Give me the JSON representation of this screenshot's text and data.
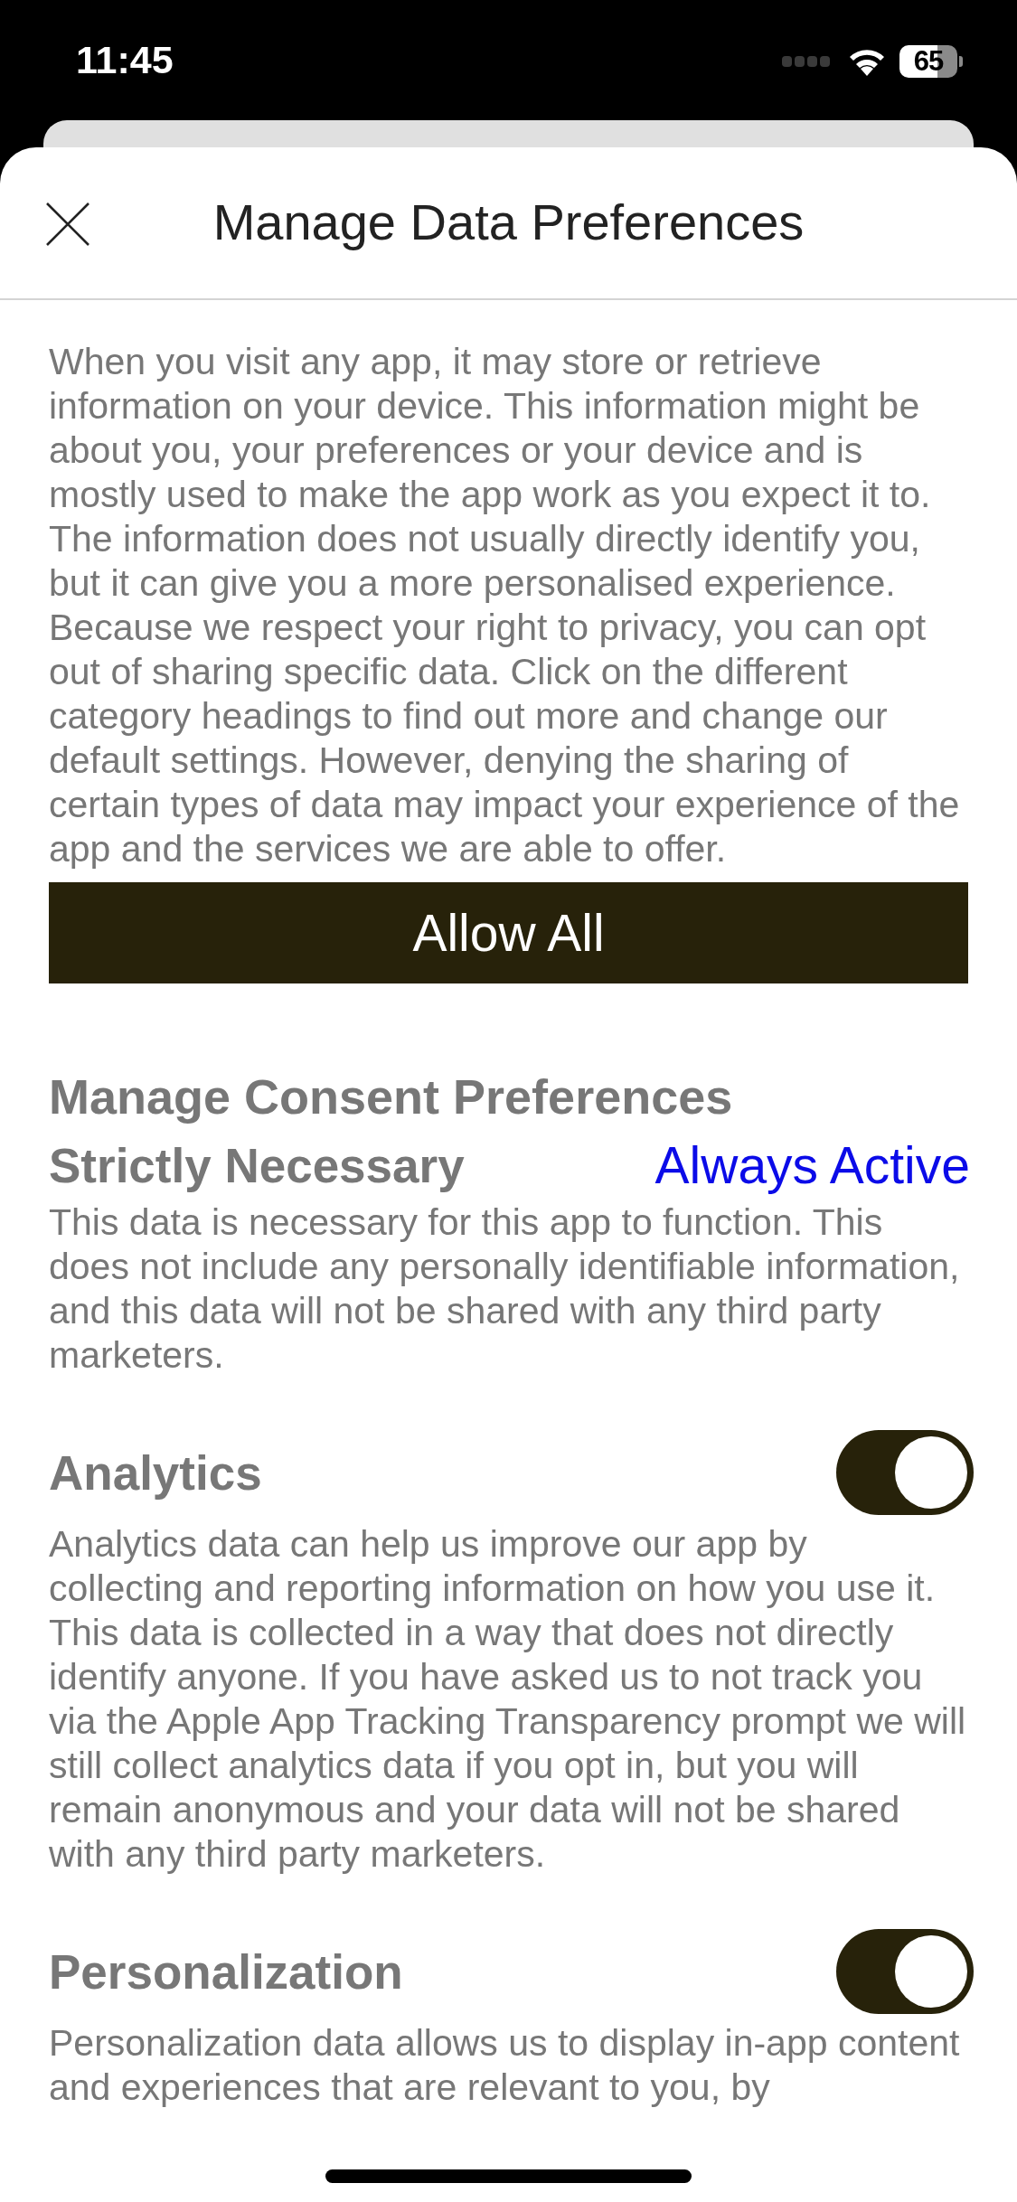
{
  "status_bar": {
    "time": "11:45",
    "battery": "65"
  },
  "header": {
    "title": "Manage Data Preferences"
  },
  "intro": "When you visit any app, it may store or retrieve information on your device. This information might be about you, your preferences or your device and is mostly used to make the app work as you expect it to. The information does not usually directly identify you, but it can give you a more personalised experience. Because we respect your right to privacy, you can opt out of sharing specific data. Click on the different category headings to find out more and change our default settings. However, denying the sharing of certain types of data may impact your experience of the app and the services we are able to offer.",
  "allow_all_button": "Allow All",
  "section_title": "Manage Consent Preferences",
  "categories": [
    {
      "kind": "always",
      "name": "Strictly Necessary",
      "status": "Always Active",
      "description": "This data is necessary for this app to function. This does not include any personally identifiable information, and this data will not be shared with any third party marketers."
    },
    {
      "kind": "toggle",
      "name": "Analytics",
      "on": true,
      "description": "Analytics data can help us improve our app by collecting and reporting information on how you use it. This data is collected in a way that does not directly identify anyone. If you have asked us to not track you via the Apple App Tracking Transparency prompt we will still collect analytics data if you opt in, but you will remain anonymous and your data will not be shared with any third party marketers."
    },
    {
      "kind": "toggle",
      "name": "Personalization",
      "on": true,
      "description": "Personalization data allows us to display in-app content and experiences that are relevant to you, by"
    }
  ]
}
